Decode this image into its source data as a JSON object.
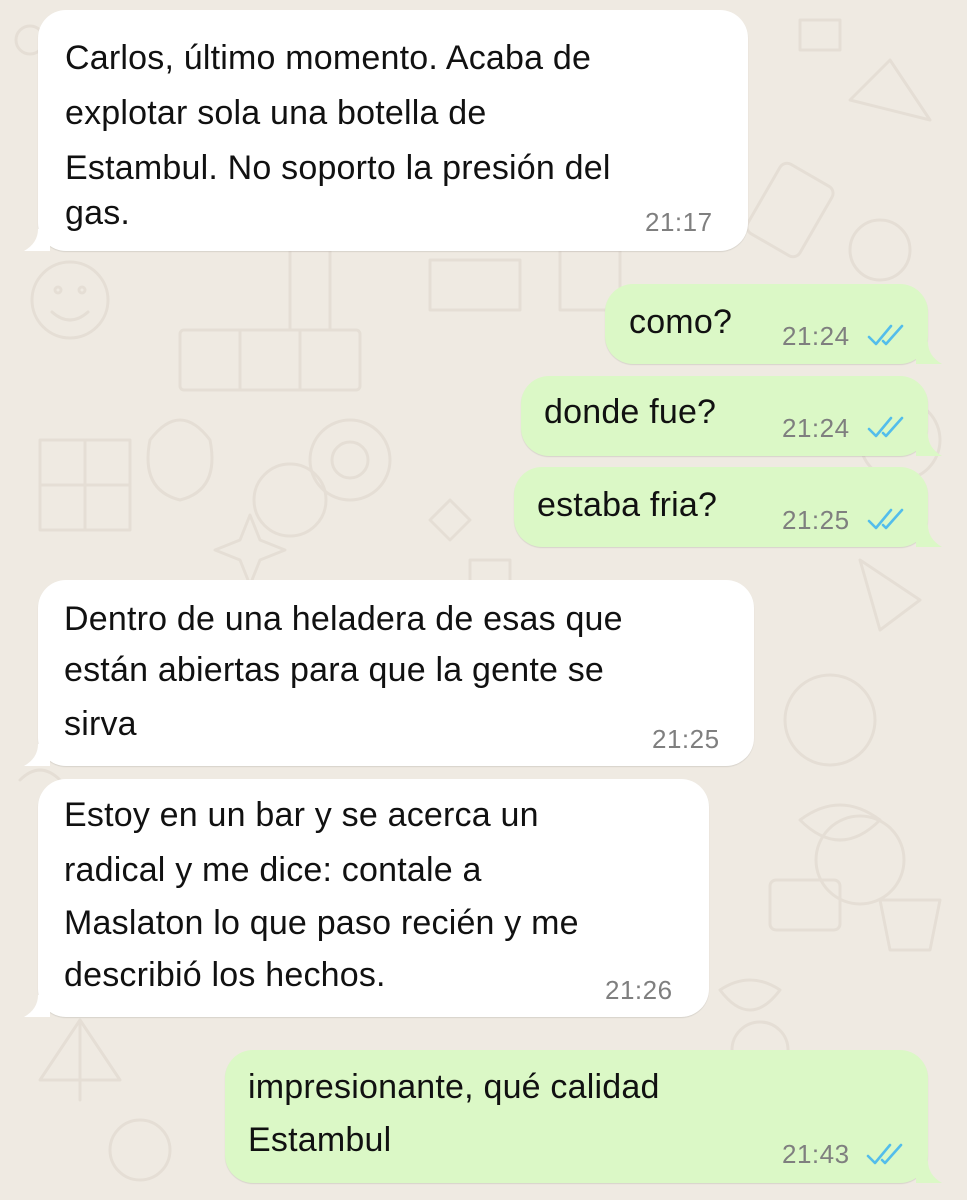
{
  "chat": {
    "accent": "#53bdeb",
    "incoming_color": "#ffffff",
    "outgoing_color": "#dbf8c6",
    "messages": [
      {
        "direction": "incoming",
        "lines": [
          "Carlos, último momento. Acaba de",
          "explotar sola una botella de",
          "Estambul. No soporto la presión del",
          "gas."
        ],
        "time": "21:17"
      },
      {
        "direction": "outgoing",
        "lines": [
          "como?"
        ],
        "time": "21:24",
        "status_icon": "double-check-icon"
      },
      {
        "direction": "outgoing",
        "lines": [
          "donde fue?"
        ],
        "time": "21:24",
        "status_icon": "double-check-icon"
      },
      {
        "direction": "outgoing",
        "lines": [
          "estaba fria?"
        ],
        "time": "21:25",
        "status_icon": "double-check-icon"
      },
      {
        "direction": "incoming",
        "lines": [
          "Dentro de una heladera de esas que",
          "están abiertas para que la gente se",
          "sirva"
        ],
        "time": "21:25"
      },
      {
        "direction": "incoming",
        "lines": [
          "Estoy en un bar y se acerca un",
          "radical y me dice: contale a",
          "Maslaton lo que paso recién y me",
          "describió los hechos."
        ],
        "time": "21:26"
      },
      {
        "direction": "outgoing",
        "lines": [
          "impresionante, qué calidad",
          "Estambul"
        ],
        "time": "21:43",
        "status_icon": "double-check-icon"
      }
    ]
  }
}
